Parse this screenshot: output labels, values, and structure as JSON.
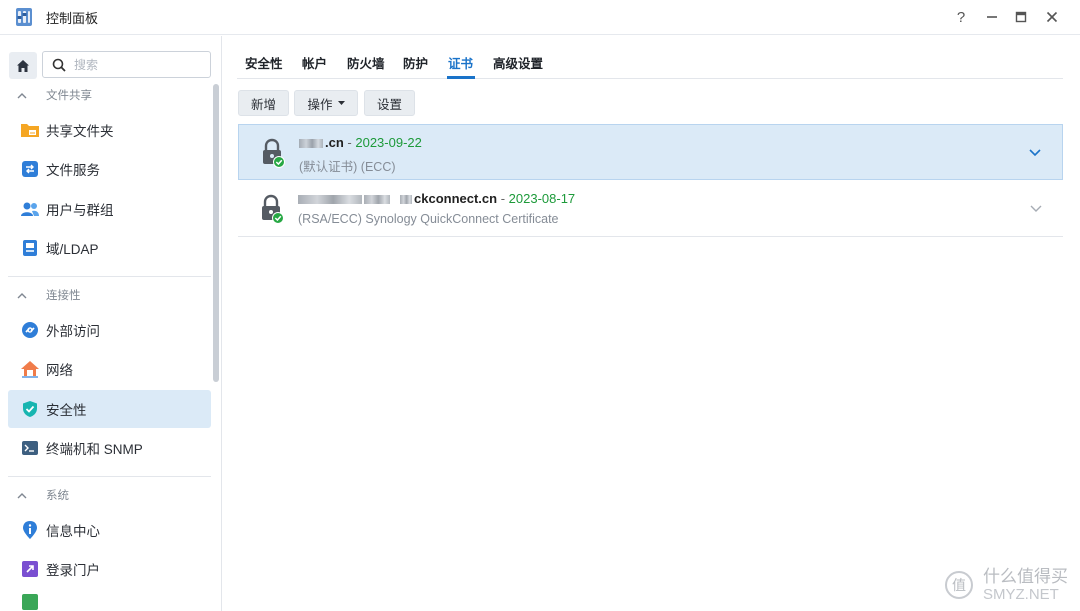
{
  "window": {
    "title": "控制面板",
    "help_glyph": "?",
    "minimize_glyph": "—",
    "maximize_glyph": "▣",
    "close_glyph": "✕"
  },
  "sidebar": {
    "search_placeholder": "搜索",
    "sections": [
      {
        "label": "文件共享",
        "items": [
          "共享文件夹",
          "文件服务",
          "用户与群组",
          "域/LDAP"
        ]
      },
      {
        "label": "连接性",
        "items": [
          "外部访问",
          "网络",
          "安全性",
          "终端机和 SNMP"
        ]
      },
      {
        "label": "系统",
        "items": [
          "信息中心",
          "登录门户"
        ]
      }
    ],
    "active_item": "安全性"
  },
  "tabs": [
    {
      "label": "安全性"
    },
    {
      "label": "帐户"
    },
    {
      "label": "防火墙"
    },
    {
      "label": "防护"
    },
    {
      "label": "证书"
    },
    {
      "label": "高级设置"
    }
  ],
  "active_tab": "证书",
  "toolbar": {
    "add_label": "新增",
    "actions_label": "操作",
    "settings_label": "设置"
  },
  "certificates": [
    {
      "domain_visible": ".cn",
      "date": "2023-09-22",
      "desc": "(默认证书) (ECC)",
      "selected": true
    },
    {
      "domain_visible": "ckconnect.cn",
      "date": "2023-08-17",
      "desc": "(RSA/ECC) Synology QuickConnect Certificate",
      "selected": false
    }
  ],
  "watermark": {
    "logo_char": "值",
    "text": "什么值得买",
    "site": "SMYZ.NET"
  },
  "colors": {
    "accent": "#1a73c9",
    "selected_bg": "#dbeaf7",
    "date_green": "#1d9a3a"
  }
}
